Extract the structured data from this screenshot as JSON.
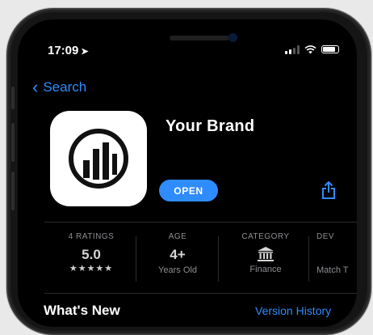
{
  "status_bar": {
    "time": "17:09",
    "location_icon": "➤",
    "battery_level": 0.85,
    "signal_bars": 2
  },
  "nav": {
    "back_label": "Search"
  },
  "app": {
    "name": "Your Brand",
    "open_label": "OPEN",
    "icon": "brand-logo-icon"
  },
  "stats": {
    "ratings": {
      "header": "4 RATINGS",
      "value": "5.0",
      "stars": "★★★★★"
    },
    "age": {
      "header": "AGE",
      "value": "4+",
      "sub": "Years Old"
    },
    "category": {
      "header": "CATEGORY",
      "icon": "bank-icon",
      "sub": "Finance"
    },
    "developer": {
      "header": "DEV",
      "sub": "Match T"
    }
  },
  "section": {
    "title": "What's New",
    "link": "Version History"
  },
  "colors": {
    "accent": "#2f8cff",
    "background": "#000000"
  }
}
